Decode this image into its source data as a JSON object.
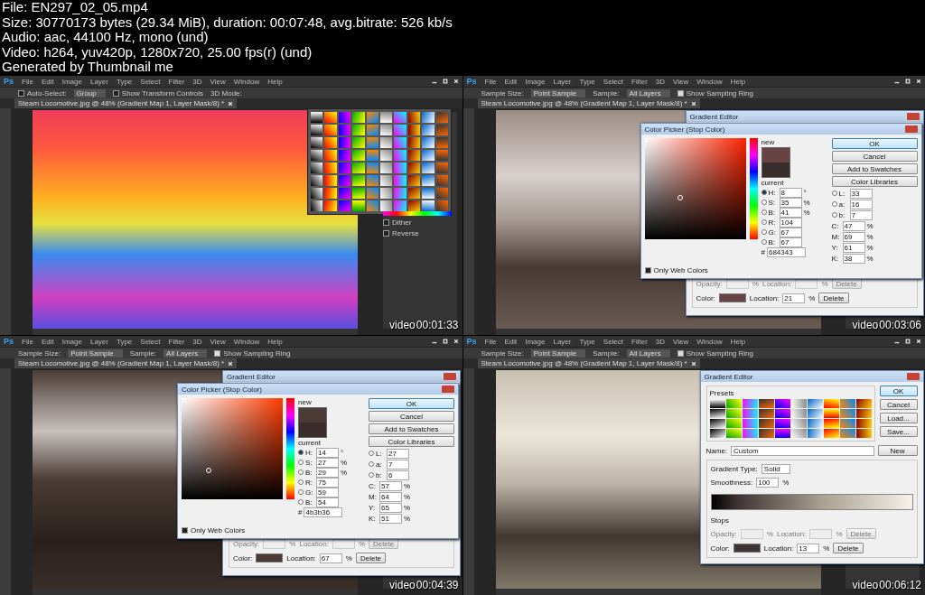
{
  "file_info": {
    "lines": [
      "File: EN297_02_05.mp4",
      "Size: 30770173 bytes (29.34 MiB), duration: 00:07:48, avg.bitrate: 526 kb/s",
      "Audio: aac, 44100 Hz, mono (und)",
      "Video: h264, yuv420p, 1280x720, 25.00 fps(r) (und)",
      "Generated by Thumbnail me"
    ]
  },
  "frames": [
    {
      "logo": "Ps",
      "menu": [
        "File",
        "Edit",
        "Image",
        "Layer",
        "Type",
        "Select",
        "Filter",
        "3D",
        "View",
        "Window",
        "Help"
      ],
      "options": [
        {
          "kind": "checkbox",
          "text": "Auto-Select:",
          "checked": false
        },
        {
          "kind": "dropdown",
          "text": "Group"
        },
        {
          "kind": "checkbox",
          "text": "Show Transform Controls",
          "checked": false
        },
        {
          "kind": "label",
          "text": "3D Mode:"
        }
      ],
      "document_tab": "Steam Locomotive.jpg @ 48% (Gradient Map 1, Layer Mask/8) *",
      "photo": {
        "kind": "gradient-map"
      },
      "overlay": {
        "kind": "gradient-picker",
        "options": [
          {
            "text": "Dither",
            "checked": false
          },
          {
            "text": "Reverse",
            "checked": false
          }
        ]
      },
      "timestamp_label": "video",
      "timestamp": "00:01:33"
    },
    {
      "logo": "Ps",
      "menu": [
        "File",
        "Edit",
        "Image",
        "Layer",
        "Type",
        "Select",
        "Filter",
        "3D",
        "View",
        "Window",
        "Help"
      ],
      "options": [
        {
          "kind": "label",
          "text": "Sample Size:"
        },
        {
          "kind": "dropdown",
          "text": "Point Sample"
        },
        {
          "kind": "label",
          "text": "Sample:"
        },
        {
          "kind": "dropdown",
          "text": "All Layers"
        },
        {
          "kind": "checkbox",
          "text": "Show Sampling Ring",
          "checked": true
        }
      ],
      "document_tab": "Steam Locomotive.jpg @ 48% (Gradient Map 1, Layer Mask/8) *",
      "photo": {
        "kind": "sepia"
      },
      "overlay": {
        "kind": "color-picker",
        "editor": {
          "title": "Gradient Editor",
          "opacity_label": "Opacity:",
          "opacity_unit": "%",
          "stop_location_label": "Location:",
          "stop_location_unit": "%",
          "stop_delete": "Delete",
          "color_label": "Color:",
          "location_label": "Location:",
          "location": "21",
          "location_unit": "%",
          "delete": "Delete"
        },
        "picker": {
          "title": "Color Picker (Stop Color)",
          "new_label": "new",
          "current_label": "current",
          "buttons": [
            "OK",
            "Cancel",
            "Add to Swatches",
            "Color Libraries"
          ],
          "radio_fields": [
            {
              "label": "H:",
              "value": "8",
              "unit": "°",
              "selected": true
            },
            {
              "label": "S:",
              "value": "35",
              "unit": "%",
              "selected": false
            },
            {
              "label": "B:",
              "value": "41",
              "unit": "%",
              "selected": false
            },
            {
              "label": "R:",
              "value": "104",
              "selected": false
            },
            {
              "label": "G:",
              "value": "67",
              "selected": false
            },
            {
              "label": "B:",
              "value": "67",
              "selected": false
            }
          ],
          "lab_fields": [
            {
              "label": "L:",
              "value": "33",
              "selected": false
            },
            {
              "label": "a:",
              "value": "16",
              "selected": false
            },
            {
              "label": "b:",
              "value": "7",
              "selected": false
            }
          ],
          "cmyk_fields": [
            {
              "label": "C:",
              "value": "47",
              "unit": "%"
            },
            {
              "label": "M:",
              "value": "69",
              "unit": "%"
            },
            {
              "label": "Y:",
              "value": "61",
              "unit": "%"
            },
            {
              "label": "K:",
              "value": "38",
              "unit": "%"
            }
          ],
          "hex_label": "#",
          "hex": "684343",
          "web_only": {
            "text": "Only Web Colors",
            "checked": false
          }
        }
      },
      "timestamp_label": "video",
      "timestamp": "00:03:06"
    },
    {
      "logo": "Ps",
      "menu": [
        "File",
        "Edit",
        "Image",
        "Layer",
        "Type",
        "Select",
        "Filter",
        "3D",
        "View",
        "Window",
        "Help"
      ],
      "options": [
        {
          "kind": "label",
          "text": "Sample Size:"
        },
        {
          "kind": "dropdown",
          "text": "Point Sample"
        },
        {
          "kind": "label",
          "text": "Sample:"
        },
        {
          "kind": "dropdown",
          "text": "All Layers"
        },
        {
          "kind": "checkbox",
          "text": "Show Sampling Ring",
          "checked": true
        }
      ],
      "document_tab": "Steam Locomotive.jpg @ 48% (Gradient Map 1, Layer Mask/8) *",
      "photo": {
        "kind": "dark-sepia"
      },
      "overlay": {
        "kind": "color-picker",
        "editor": {
          "title": "Gradient Editor",
          "opacity_label": "Opacity:",
          "opacity_unit": "%",
          "stop_location_label": "Location:",
          "stop_location_unit": "%",
          "stop_delete": "Delete",
          "color_label": "Color:",
          "location_label": "Location:",
          "location": "67",
          "location_unit": "%",
          "delete": "Delete"
        },
        "picker": {
          "title": "Color Picker (Stop Color)",
          "new_label": "new",
          "current_label": "current",
          "buttons": [
            "OK",
            "Cancel",
            "Add to Swatches",
            "Color Libraries"
          ],
          "radio_fields": [
            {
              "label": "H:",
              "value": "14",
              "unit": "°",
              "selected": true
            },
            {
              "label": "S:",
              "value": "27",
              "unit": "%",
              "selected": false
            },
            {
              "label": "B:",
              "value": "29",
              "unit": "%",
              "selected": false
            },
            {
              "label": "R:",
              "value": "75",
              "selected": false
            },
            {
              "label": "G:",
              "value": "59",
              "selected": false
            },
            {
              "label": "B:",
              "value": "54",
              "selected": false
            }
          ],
          "lab_fields": [
            {
              "label": "L:",
              "value": "27",
              "selected": false
            },
            {
              "label": "a:",
              "value": "7",
              "selected": false
            },
            {
              "label": "b:",
              "value": "6",
              "selected": false
            }
          ],
          "cmyk_fields": [
            {
              "label": "C:",
              "value": "57",
              "unit": "%"
            },
            {
              "label": "M:",
              "value": "64",
              "unit": "%"
            },
            {
              "label": "Y:",
              "value": "65",
              "unit": "%"
            },
            {
              "label": "K:",
              "value": "51",
              "unit": "%"
            }
          ],
          "hex_label": "#",
          "hex": "4b3b36",
          "web_only": {
            "text": "Only Web Colors",
            "checked": false
          }
        }
      },
      "timestamp_label": "video",
      "timestamp": "00:04:39"
    },
    {
      "logo": "Ps",
      "menu": [
        "File",
        "Edit",
        "Image",
        "Layer",
        "Type",
        "Select",
        "Filter",
        "3D",
        "View",
        "Window",
        "Help"
      ],
      "options": [
        {
          "kind": "label",
          "text": "Sample Size:"
        },
        {
          "kind": "dropdown",
          "text": "Point Sample"
        },
        {
          "kind": "label",
          "text": "Sample:"
        },
        {
          "kind": "dropdown",
          "text": "All Layers"
        },
        {
          "kind": "checkbox",
          "text": "Show Sampling Ring",
          "checked": true
        }
      ],
      "document_tab": "Steam Locomotive.jpg @ 48% (Gradient Map 1, Layer Mask/8) *",
      "photo": {
        "kind": "light-sepia"
      },
      "overlay": {
        "kind": "gradient-editor",
        "title": "Gradient Editor",
        "presets_label": "Presets",
        "buttons": [
          "OK",
          "Cancel",
          "Load...",
          "Save..."
        ],
        "name_label": "Name:",
        "name": "Custom",
        "new_button": "New",
        "type_label": "Gradient Type:",
        "type": "Solid",
        "smoothness_label": "Smoothness:",
        "smoothness": "100",
        "smoothness_unit": "%",
        "stops_label": "Stops",
        "opacity_label": "Opacity:",
        "opacity_unit": "%",
        "stop_location_label": "Location:",
        "stop_location_unit": "%",
        "stop_delete": "Delete",
        "color_label": "Color:",
        "location_label": "Location:",
        "location": "13",
        "location_unit": "%",
        "delete": "Delete"
      },
      "timestamp_label": "video",
      "timestamp": "00:06:12"
    }
  ]
}
